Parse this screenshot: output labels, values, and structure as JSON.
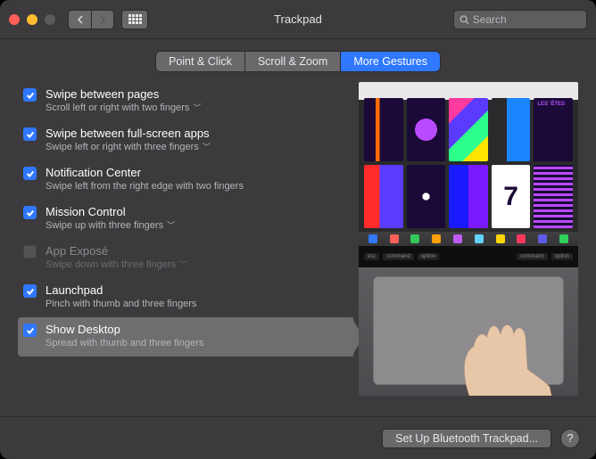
{
  "window": {
    "title": "Trackpad"
  },
  "search": {
    "placeholder": "Search"
  },
  "tabs": [
    {
      "label": "Point & Click",
      "active": false
    },
    {
      "label": "Scroll & Zoom",
      "active": false
    },
    {
      "label": "More Gestures",
      "active": true
    }
  ],
  "options": [
    {
      "title": "Swipe between pages",
      "desc": "Scroll left or right with two fingers",
      "dropdown": true,
      "checked": true,
      "enabled": true,
      "selected": false
    },
    {
      "title": "Swipe between full-screen apps",
      "desc": "Swipe left or right with three fingers",
      "dropdown": true,
      "checked": true,
      "enabled": true,
      "selected": false
    },
    {
      "title": "Notification Center",
      "desc": "Swipe left from the right edge with two fingers",
      "dropdown": false,
      "checked": true,
      "enabled": true,
      "selected": false
    },
    {
      "title": "Mission Control",
      "desc": "Swipe up with three fingers",
      "dropdown": true,
      "checked": true,
      "enabled": true,
      "selected": false
    },
    {
      "title": "App Exposé",
      "desc": "Swipe down with three fingers",
      "dropdown": true,
      "checked": false,
      "enabled": false,
      "selected": false
    },
    {
      "title": "Launchpad",
      "desc": "Pinch with thumb and three fingers",
      "dropdown": false,
      "checked": true,
      "enabled": true,
      "selected": false
    },
    {
      "title": "Show Desktop",
      "desc": "Spread with thumb and three fingers",
      "dropdown": false,
      "checked": true,
      "enabled": true,
      "selected": true
    }
  ],
  "footer": {
    "button": "Set Up Bluetooth Trackpad...",
    "help": "?"
  },
  "colors": {
    "accent": "#2f78ff",
    "bg": "#3c3a3d",
    "muted": "#b6b4b7"
  },
  "touchbar": {
    "left": [
      "esc",
      "command",
      "option"
    ],
    "right": [
      "command",
      "option"
    ]
  }
}
